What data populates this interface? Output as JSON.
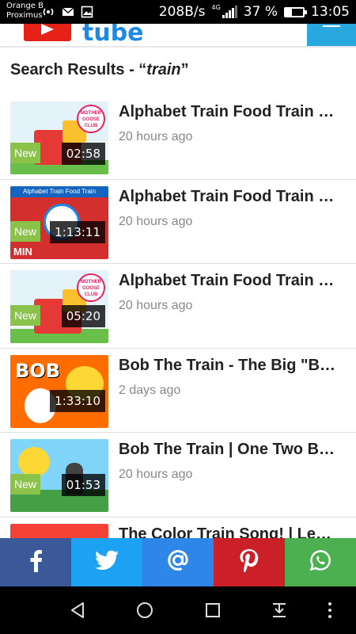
{
  "status_bar": {
    "carrier_line1": "Orange B",
    "carrier_line2": "Proximus",
    "speed": "208B/s",
    "network": "4G",
    "battery": "37 %",
    "battery_level": 0.37,
    "time": "13:05"
  },
  "app_bar": {
    "logo_text": "tube"
  },
  "search": {
    "prefix": "Search Results - “",
    "query": "train",
    "suffix": "”"
  },
  "results": [
    {
      "title": "Alphabet Train Food Train Song | ABC Song | Mother Goose Club",
      "age": "20 hours ago",
      "duration": "02:58",
      "badge": "New",
      "thumb_text": "MOTHER GOOSE CLUB"
    },
    {
      "title": "Alphabet Train Food Train Song Compilation",
      "age": "20 hours ago",
      "duration": "1:13:11",
      "badge": "New",
      "thumb_text": "Alphabet Train Food Train",
      "thumb_corner": "MIN"
    },
    {
      "title": "Alphabet Train Food Train Song | Mother Goose Club",
      "age": "20 hours ago",
      "duration": "05:20",
      "badge": "New",
      "thumb_text": "MOTHER GOOSE CLUB"
    },
    {
      "title": "Bob The Train - The Big \"Bob\" Compilation",
      "age": "2 days ago",
      "duration": "1:33:10",
      "thumb_text": "BOB"
    },
    {
      "title": "Bob The Train | One Two Buckle My Shoe",
      "age": "20 hours ago",
      "duration": "01:53",
      "badge": "New"
    },
    {
      "title": "The Color Train Song! | Learn Colors"
    }
  ],
  "share": [
    {
      "name": "facebook",
      "icon": "facebook-icon"
    },
    {
      "name": "twitter",
      "icon": "twitter-icon"
    },
    {
      "name": "email",
      "icon": "at-sign-icon"
    },
    {
      "name": "pinterest",
      "icon": "pinterest-icon"
    },
    {
      "name": "whatsapp",
      "icon": "whatsapp-icon"
    }
  ],
  "colors": {
    "facebook": "#3b5998",
    "twitter": "#1da1f2",
    "email": "#2e86e8",
    "pinterest": "#cb2027",
    "whatsapp": "#4caf50",
    "new_badge": "#8bc34a",
    "menu_button": "#29a8e0"
  }
}
